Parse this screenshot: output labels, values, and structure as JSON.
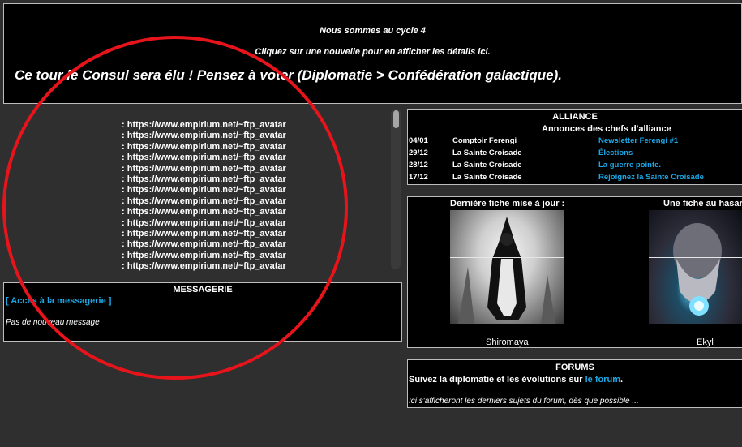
{
  "header": {
    "cycle": "Nous sommes au cycle 4",
    "click_hint": "Cliquez sur une nouvelle pour en afficher les détails ici.",
    "announcement": "Ce tour le Consul sera élu ! Pensez à voter (Diplomatie > Confédération galactique)."
  },
  "avatar_list": {
    "lines": [
      ": https://www.empirium.net/~ftp_avatar",
      ": https://www.empirium.net/~ftp_avatar",
      ": https://www.empirium.net/~ftp_avatar",
      ": https://www.empirium.net/~ftp_avatar",
      ": https://www.empirium.net/~ftp_avatar",
      ": https://www.empirium.net/~ftp_avatar",
      ": https://www.empirium.net/~ftp_avatar",
      ": https://www.empirium.net/~ftp_avatar",
      ": https://www.empirium.net/~ftp_avatar",
      ": https://www.empirium.net/~ftp_avatar",
      ": https://www.empirium.net/~ftp_avatar",
      ": https://www.empirium.net/~ftp_avatar",
      ": https://www.empirium.net/~ftp_avatar",
      ": https://www.empirium.net/~ftp_avatar"
    ]
  },
  "messagerie": {
    "title": "MESSAGERIE",
    "link": "[ Accès à la messagerie ]",
    "status": "Pas de nouveau message"
  },
  "alliance": {
    "title": "ALLIANCE",
    "subtitle": "Annonces des chefs d'alliance",
    "rows": [
      {
        "date": "04/01",
        "author": "Comptoir Ferengi",
        "title": "Newsletter Ferengi #1"
      },
      {
        "date": "29/12",
        "author": "La Sainte Croisade",
        "title": "Élections"
      },
      {
        "date": "28/12",
        "author": "La Sainte Croisade",
        "title": "La guerre pointe."
      },
      {
        "date": "17/12",
        "author": "La Sainte Croisade",
        "title": "Rejoignez la Sainte Croisade"
      }
    ]
  },
  "fiches": {
    "last_title": "Dernière fiche mise à jour :",
    "random_title": "Une fiche au hasar",
    "last_name": "Shiromaya",
    "random_name": "Ekyl"
  },
  "forums": {
    "title": "FORUMS",
    "line_prefix": "Suivez la diplomatie et les évolutions sur ",
    "link": "le forum",
    "line_suffix": ".",
    "note": "Ici s'afficheront les derniers sujets du forum, dès que possible ..."
  },
  "colors": {
    "background": "#2f2f2f",
    "panel": "#000000",
    "link": "#1ba8e6",
    "annotation_circle": "#e8141b"
  }
}
